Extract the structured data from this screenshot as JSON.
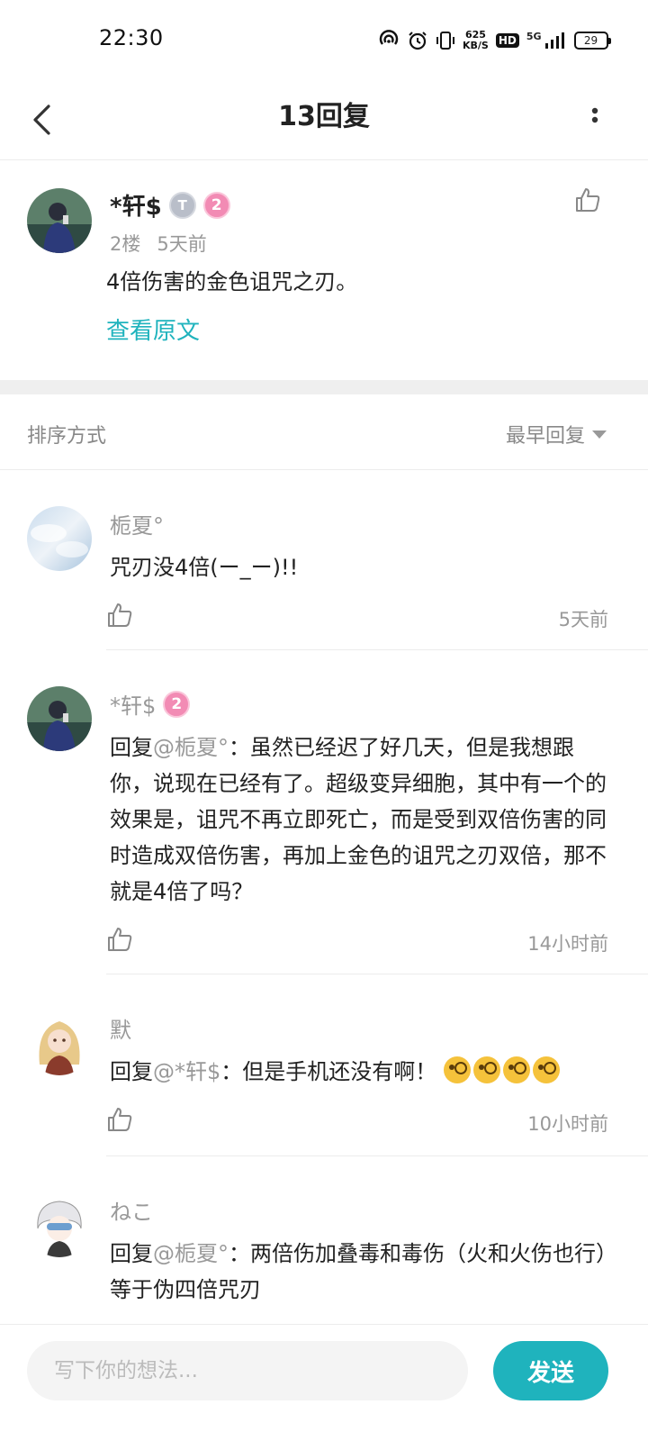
{
  "status_bar": {
    "time": "22:30",
    "net_speed_value": "625",
    "net_speed_unit": "KB/S",
    "hd": "HD",
    "network": "5G",
    "battery": "29"
  },
  "header": {
    "title": "13回复"
  },
  "main_post": {
    "author": "*轩$",
    "badge_t": "T",
    "badge_level": "2",
    "floor": "2楼",
    "time": "5天前",
    "content": "4倍伤害的金色诅咒之刃。",
    "view_original": "查看原文"
  },
  "sort": {
    "label": "排序方式",
    "selected": "最早回复"
  },
  "replies": [
    {
      "author": "栀夏°",
      "text": "咒刃没4倍(ー_ー)!!",
      "time": "5天前"
    },
    {
      "author": "*轩$",
      "badge_level": "2",
      "reply_prefix": "回复",
      "at": "@栀夏°",
      "text": "：虽然已经迟了好几天，但是我想跟你，说现在已经有了。超级变异细胞，其中有一个的效果是，诅咒不再立即死亡，而是受到双倍伤害的同时造成双倍伤害，再加上金色的诅咒之刃双倍，那不就是4倍了吗？",
      "time": "14小时前"
    },
    {
      "author": "默",
      "reply_prefix": "回复",
      "at": "@*轩$",
      "text": "：但是手机还没有啊！",
      "time": "10小时前"
    },
    {
      "author": "ねこ",
      "reply_prefix": "回复",
      "at": "@栀夏°",
      "text": "：两倍伤加叠毒和毒伤（火和火伤也行）等于伪四倍咒刃"
    }
  ],
  "input": {
    "placeholder": "写下你的想法...",
    "send_label": "发送"
  },
  "colors": {
    "accent": "#1fb3bd",
    "level_badge": "#f28bb4",
    "muted_text": "#999999"
  }
}
